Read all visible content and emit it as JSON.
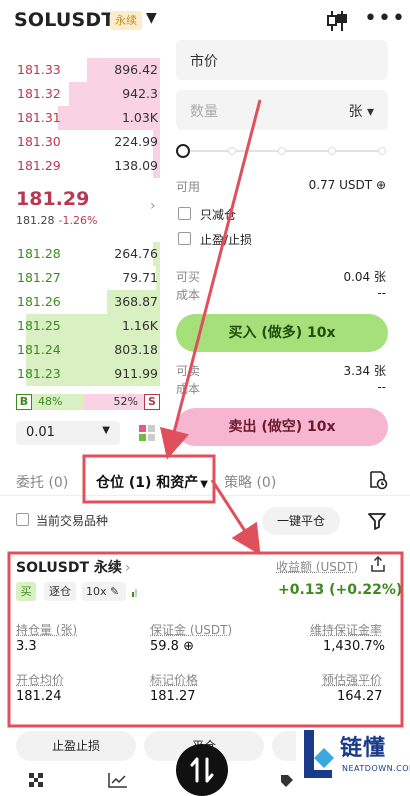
{
  "header": {
    "symbol": "SOLUSDT",
    "badge": "永续"
  },
  "orderbook": {
    "asks": [
      {
        "price": "181.33",
        "qty": "896.42",
        "depth": 0.5
      },
      {
        "price": "181.32",
        "qty": "942.3",
        "depth": 0.62
      },
      {
        "price": "181.31",
        "qty": "1.03K",
        "depth": 0.7
      },
      {
        "price": "181.30",
        "qty": "224.99",
        "depth": 0.05
      },
      {
        "price": "181.29",
        "qty": "138.09",
        "depth": 0.05
      }
    ],
    "last_price": "181.29",
    "mark_price": "181.28",
    "change": "-1.26%",
    "bids": [
      {
        "price": "181.28",
        "qty": "264.76",
        "depth": 0.05
      },
      {
        "price": "181.27",
        "qty": "79.71",
        "depth": 0.03
      },
      {
        "price": "181.26",
        "qty": "368.87",
        "depth": 0.36
      },
      {
        "price": "181.25",
        "qty": "1.16K",
        "depth": 0.92
      },
      {
        "price": "181.24",
        "qty": "803.18",
        "depth": 0.92
      },
      {
        "price": "181.23",
        "qty": "911.99",
        "depth": 0.92
      }
    ],
    "ratio": {
      "buy_letter": "B",
      "buy_pct": "48%",
      "sell_pct": "52%",
      "sell_letter": "S"
    },
    "depth_step": "0.01"
  },
  "form": {
    "price_label": "市价",
    "qty_placeholder": "数量",
    "qty_unit": "张",
    "available_label": "可用",
    "available_value": "0.77 USDT",
    "reduce_only": "只减仓",
    "tpsl": "止盈/止损",
    "can_buy_label": "可买",
    "can_buy_value": "0.04 张",
    "cost_label": "成本",
    "cost_value": "--",
    "buy_button": "买入 (做多) 10x",
    "can_sell_label": "可卖",
    "can_sell_value": "3.34 张",
    "cost2_label": "成本",
    "cost2_value": "--",
    "sell_button": "卖出 (做空) 10x"
  },
  "tabs": {
    "orders": "委托 (0)",
    "positions": "仓位 (1) 和资产",
    "strategy": "策略 (0)"
  },
  "list": {
    "current_only": "当前交易品种",
    "close_all": "一键平仓"
  },
  "position": {
    "symbol": "SOLUSDT 永续",
    "pnl_label": "收益额 (USDT)",
    "side": "买",
    "margin_mode": "逐仓",
    "leverage": "10x",
    "pnl": "+0.13 (+0.22%)",
    "size_label": "持仓量 (张)",
    "size": "3.3",
    "margin_label": "保证金 (USDT)",
    "margin": "59.8",
    "mmr_label": "维持保证金率",
    "mmr": "1,430.7%",
    "entry_label": "开仓均价",
    "entry": "181.24",
    "mark_label": "标记价格",
    "mark": "181.27",
    "liq_label": "预估强平价",
    "liq": "164.27"
  },
  "actions": {
    "tpsl": "止盈止损",
    "close": "平仓"
  },
  "watermark": {
    "text": "链懂",
    "sub": "NEATDOWN.COM"
  },
  "colors": {
    "ask": "#b8384f",
    "bid": "#3d8b1f",
    "annotation": "#e0505c"
  }
}
